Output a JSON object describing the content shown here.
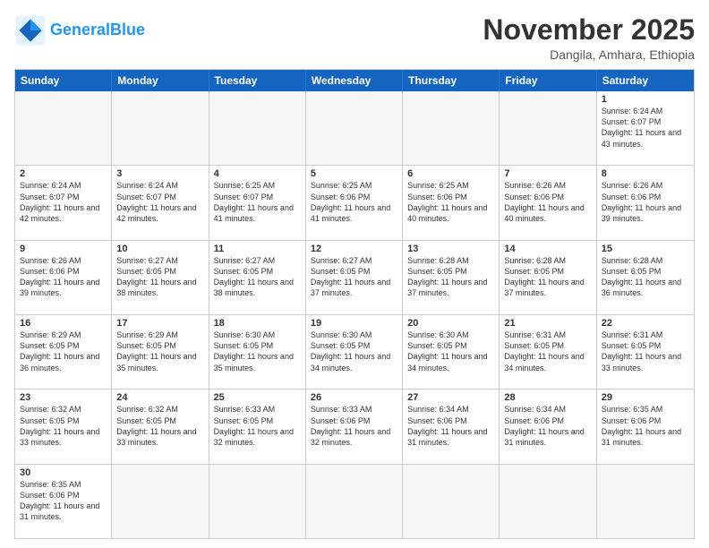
{
  "logo": {
    "general": "General",
    "blue": "Blue"
  },
  "title": "November 2025",
  "location": "Dangila, Amhara, Ethiopia",
  "header_days": [
    "Sunday",
    "Monday",
    "Tuesday",
    "Wednesday",
    "Thursday",
    "Friday",
    "Saturday"
  ],
  "rows": [
    [
      {
        "day": "",
        "text": "",
        "empty": true
      },
      {
        "day": "",
        "text": "",
        "empty": true
      },
      {
        "day": "",
        "text": "",
        "empty": true
      },
      {
        "day": "",
        "text": "",
        "empty": true
      },
      {
        "day": "",
        "text": "",
        "empty": true
      },
      {
        "day": "",
        "text": "",
        "empty": true
      },
      {
        "day": "1",
        "text": "Sunrise: 6:24 AM\nSunset: 6:07 PM\nDaylight: 11 hours and 43 minutes.",
        "empty": false
      }
    ],
    [
      {
        "day": "2",
        "text": "Sunrise: 6:24 AM\nSunset: 6:07 PM\nDaylight: 11 hours and 42 minutes.",
        "empty": false
      },
      {
        "day": "3",
        "text": "Sunrise: 6:24 AM\nSunset: 6:07 PM\nDaylight: 11 hours and 42 minutes.",
        "empty": false
      },
      {
        "day": "4",
        "text": "Sunrise: 6:25 AM\nSunset: 6:07 PM\nDaylight: 11 hours and 41 minutes.",
        "empty": false
      },
      {
        "day": "5",
        "text": "Sunrise: 6:25 AM\nSunset: 6:06 PM\nDaylight: 11 hours and 41 minutes.",
        "empty": false
      },
      {
        "day": "6",
        "text": "Sunrise: 6:25 AM\nSunset: 6:06 PM\nDaylight: 11 hours and 40 minutes.",
        "empty": false
      },
      {
        "day": "7",
        "text": "Sunrise: 6:26 AM\nSunset: 6:06 PM\nDaylight: 11 hours and 40 minutes.",
        "empty": false
      },
      {
        "day": "8",
        "text": "Sunrise: 6:26 AM\nSunset: 6:06 PM\nDaylight: 11 hours and 39 minutes.",
        "empty": false
      }
    ],
    [
      {
        "day": "9",
        "text": "Sunrise: 6:26 AM\nSunset: 6:06 PM\nDaylight: 11 hours and 39 minutes.",
        "empty": false
      },
      {
        "day": "10",
        "text": "Sunrise: 6:27 AM\nSunset: 6:05 PM\nDaylight: 11 hours and 38 minutes.",
        "empty": false
      },
      {
        "day": "11",
        "text": "Sunrise: 6:27 AM\nSunset: 6:05 PM\nDaylight: 11 hours and 38 minutes.",
        "empty": false
      },
      {
        "day": "12",
        "text": "Sunrise: 6:27 AM\nSunset: 6:05 PM\nDaylight: 11 hours and 37 minutes.",
        "empty": false
      },
      {
        "day": "13",
        "text": "Sunrise: 6:28 AM\nSunset: 6:05 PM\nDaylight: 11 hours and 37 minutes.",
        "empty": false
      },
      {
        "day": "14",
        "text": "Sunrise: 6:28 AM\nSunset: 6:05 PM\nDaylight: 11 hours and 37 minutes.",
        "empty": false
      },
      {
        "day": "15",
        "text": "Sunrise: 6:28 AM\nSunset: 6:05 PM\nDaylight: 11 hours and 36 minutes.",
        "empty": false
      }
    ],
    [
      {
        "day": "16",
        "text": "Sunrise: 6:29 AM\nSunset: 6:05 PM\nDaylight: 11 hours and 36 minutes.",
        "empty": false
      },
      {
        "day": "17",
        "text": "Sunrise: 6:29 AM\nSunset: 6:05 PM\nDaylight: 11 hours and 35 minutes.",
        "empty": false
      },
      {
        "day": "18",
        "text": "Sunrise: 6:30 AM\nSunset: 6:05 PM\nDaylight: 11 hours and 35 minutes.",
        "empty": false
      },
      {
        "day": "19",
        "text": "Sunrise: 6:30 AM\nSunset: 6:05 PM\nDaylight: 11 hours and 34 minutes.",
        "empty": false
      },
      {
        "day": "20",
        "text": "Sunrise: 6:30 AM\nSunset: 6:05 PM\nDaylight: 11 hours and 34 minutes.",
        "empty": false
      },
      {
        "day": "21",
        "text": "Sunrise: 6:31 AM\nSunset: 6:05 PM\nDaylight: 11 hours and 34 minutes.",
        "empty": false
      },
      {
        "day": "22",
        "text": "Sunrise: 6:31 AM\nSunset: 6:05 PM\nDaylight: 11 hours and 33 minutes.",
        "empty": false
      }
    ],
    [
      {
        "day": "23",
        "text": "Sunrise: 6:32 AM\nSunset: 6:05 PM\nDaylight: 11 hours and 33 minutes.",
        "empty": false
      },
      {
        "day": "24",
        "text": "Sunrise: 6:32 AM\nSunset: 6:05 PM\nDaylight: 11 hours and 33 minutes.",
        "empty": false
      },
      {
        "day": "25",
        "text": "Sunrise: 6:33 AM\nSunset: 6:05 PM\nDaylight: 11 hours and 32 minutes.",
        "empty": false
      },
      {
        "day": "26",
        "text": "Sunrise: 6:33 AM\nSunset: 6:06 PM\nDaylight: 11 hours and 32 minutes.",
        "empty": false
      },
      {
        "day": "27",
        "text": "Sunrise: 6:34 AM\nSunset: 6:06 PM\nDaylight: 11 hours and 31 minutes.",
        "empty": false
      },
      {
        "day": "28",
        "text": "Sunrise: 6:34 AM\nSunset: 6:06 PM\nDaylight: 11 hours and 31 minutes.",
        "empty": false
      },
      {
        "day": "29",
        "text": "Sunrise: 6:35 AM\nSunset: 6:06 PM\nDaylight: 11 hours and 31 minutes.",
        "empty": false
      }
    ],
    [
      {
        "day": "30",
        "text": "Sunrise: 6:35 AM\nSunset: 6:06 PM\nDaylight: 11 hours and 31 minutes.",
        "empty": false
      },
      {
        "day": "",
        "text": "",
        "empty": true
      },
      {
        "day": "",
        "text": "",
        "empty": true
      },
      {
        "day": "",
        "text": "",
        "empty": true
      },
      {
        "day": "",
        "text": "",
        "empty": true
      },
      {
        "day": "",
        "text": "",
        "empty": true
      },
      {
        "day": "",
        "text": "",
        "empty": true
      }
    ]
  ]
}
